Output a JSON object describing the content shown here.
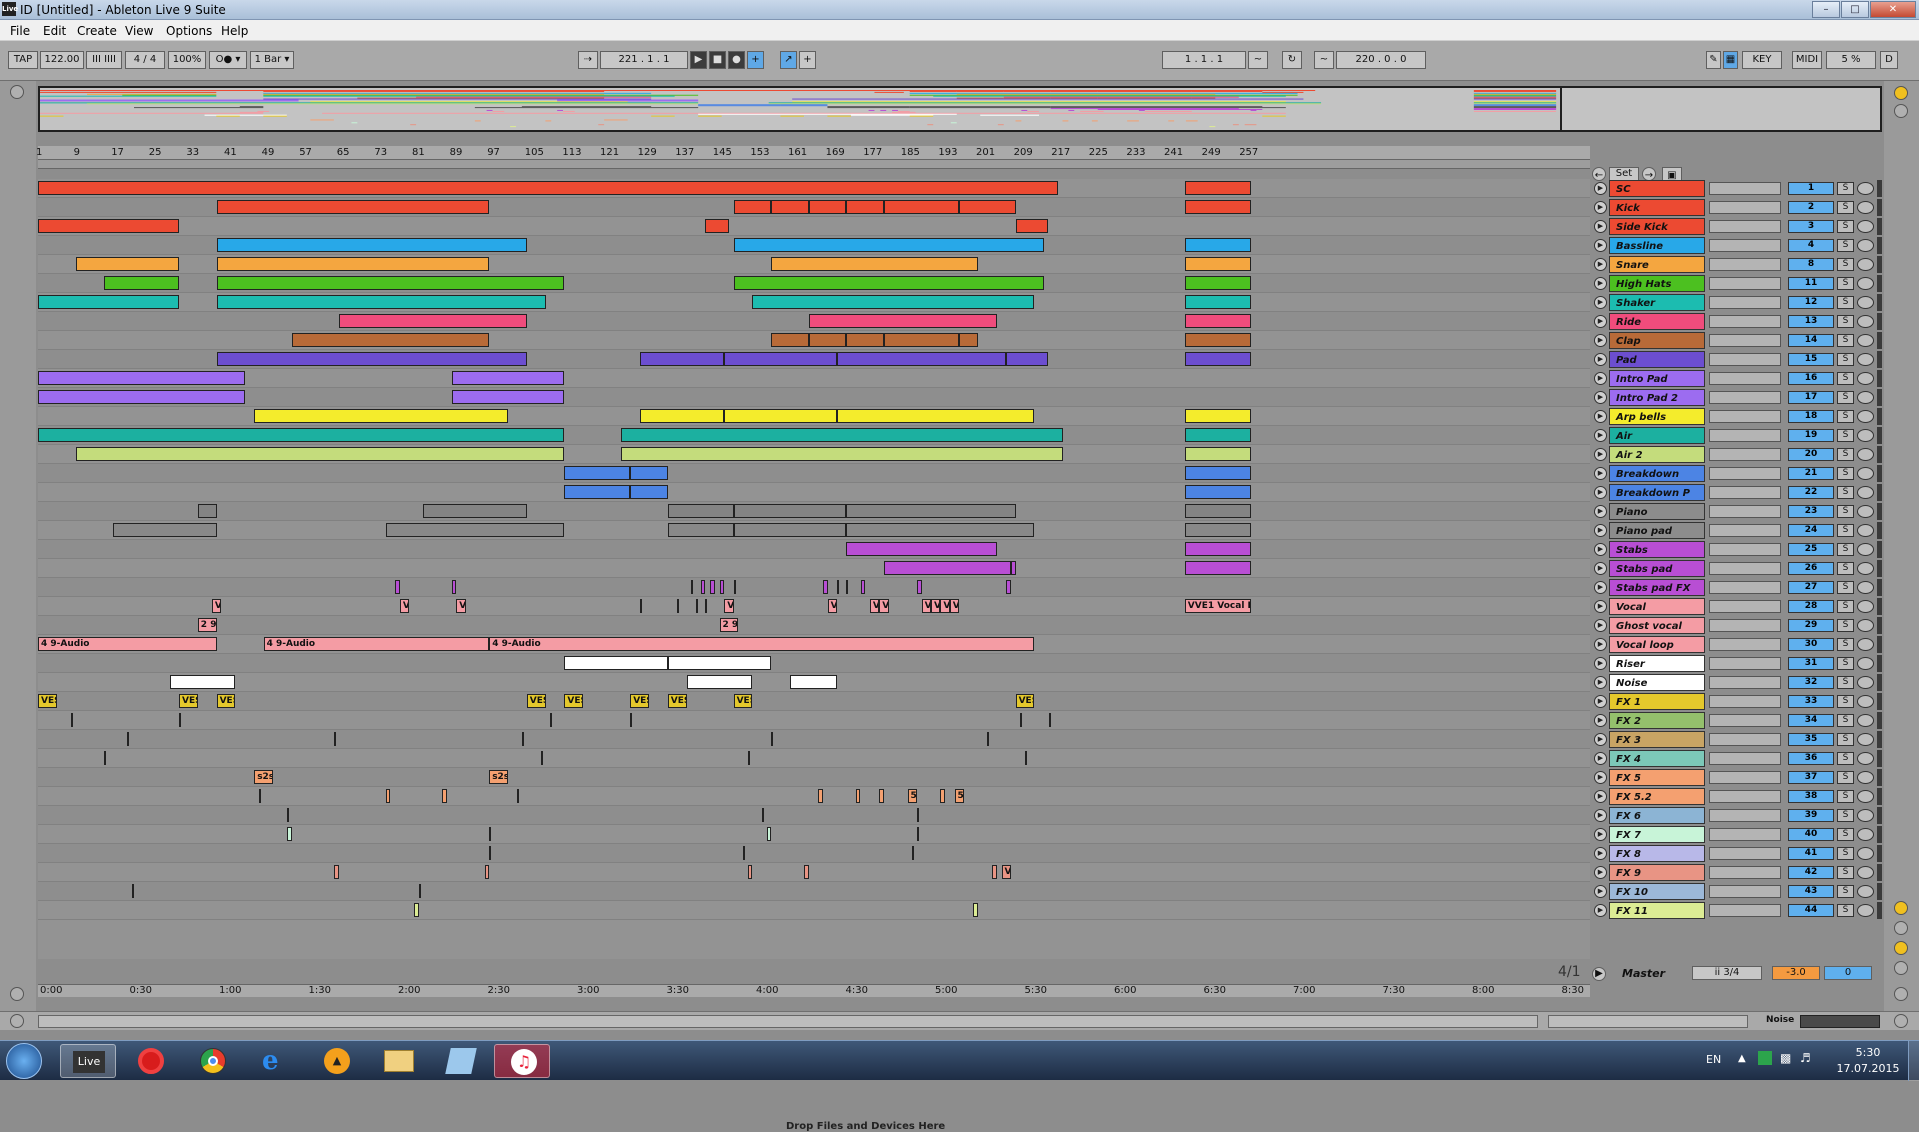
{
  "window": {
    "title": "ID  [Untitled] - Ableton Live 9 Suite",
    "app_icon": "Live"
  },
  "menu": [
    "File",
    "Edit",
    "Create",
    "View",
    "Options",
    "Help"
  ],
  "transport": {
    "tap": "TAP",
    "tempo": "122.00",
    "metronome_bars": "III  IIII",
    "signature": "4 / 4",
    "zoom": "100%",
    "rec_mode": "O● ▾",
    "quantize": "1 Bar ▾",
    "follow": "⇢",
    "position": "221 .  1 .  1",
    "loop_start": "1 .  1 .  1",
    "loop_length": "220 .  0 .  0",
    "key_btn": "KEY",
    "midi_btn": "MIDI",
    "cpu": "5 %",
    "d_btn": "D"
  },
  "ruler_bars": [
    "1",
    "9",
    "17",
    "25",
    "33",
    "41",
    "49",
    "57",
    "65",
    "73",
    "81",
    "89",
    "97",
    "105",
    "113",
    "121",
    "129",
    "137",
    "145",
    "153",
    "161",
    "169",
    "177",
    "185",
    "193",
    "201",
    "209",
    "217",
    "225",
    "233",
    "241",
    "249",
    "257"
  ],
  "time_ruler": [
    "0:00",
    "0:30",
    "1:00",
    "1:30",
    "2:00",
    "2:30",
    "3:00",
    "3:30",
    "4:00",
    "4:30",
    "5:00",
    "5:30",
    "6:00",
    "6:30",
    "7:00",
    "7:30",
    "8:00",
    "8:30"
  ],
  "drop_text": "Drop Files and Devices Here",
  "set_btn": "Set",
  "tracks": [
    {
      "name": "SC",
      "color": "#ec4a32",
      "num": "1",
      "solo": "S"
    },
    {
      "name": "Kick",
      "color": "#ec4a32",
      "num": "2",
      "solo": "S"
    },
    {
      "name": "Side Kick",
      "color": "#ec4a32",
      "num": "3",
      "solo": "S"
    },
    {
      "name": "Bassline",
      "color": "#28a8e8",
      "num": "4",
      "solo": "S"
    },
    {
      "name": "Snare",
      "color": "#f4a640",
      "num": "8",
      "solo": "S"
    },
    {
      "name": "High Hats",
      "color": "#4cc020",
      "num": "11",
      "solo": "S"
    },
    {
      "name": "Shaker",
      "color": "#1cbcb0",
      "num": "12",
      "solo": "S"
    },
    {
      "name": "Ride",
      "color": "#f04c7c",
      "num": "13",
      "solo": "S"
    },
    {
      "name": "Clap",
      "color": "#b86a38",
      "num": "14",
      "solo": "S"
    },
    {
      "name": "Pad",
      "color": "#6c4ed0",
      "num": "15",
      "solo": "S"
    },
    {
      "name": "Intro Pad",
      "color": "#9c6cf0",
      "num": "16",
      "solo": "S"
    },
    {
      "name": "Intro Pad 2",
      "color": "#9c6cf0",
      "num": "17",
      "solo": "S"
    },
    {
      "name": "Arp bells",
      "color": "#f4ec2c",
      "num": "18",
      "solo": "S"
    },
    {
      "name": "Air",
      "color": "#1cb0a0",
      "num": "19",
      "solo": "S"
    },
    {
      "name": "Air 2",
      "color": "#c4dc7c",
      "num": "20",
      "solo": "S"
    },
    {
      "name": "Breakdown",
      "color": "#4c84e4",
      "num": "21",
      "solo": "S"
    },
    {
      "name": "Breakdown P",
      "color": "#4c84e4",
      "num": "22",
      "solo": "S"
    },
    {
      "name": "Piano",
      "color": "#8c8c8c",
      "num": "23",
      "solo": "S"
    },
    {
      "name": "Piano pad",
      "color": "#8c8c8c",
      "num": "24",
      "solo": "S"
    },
    {
      "name": "Stabs",
      "color": "#b84ed4",
      "num": "25",
      "solo": "S"
    },
    {
      "name": "Stabs pad",
      "color": "#b84ed4",
      "num": "26",
      "solo": "S"
    },
    {
      "name": "Stabs pad FX",
      "color": "#b84ed4",
      "num": "27",
      "solo": "S"
    },
    {
      "name": "Vocal",
      "color": "#f49ca4",
      "num": "28",
      "solo": "S"
    },
    {
      "name": "Ghost vocal",
      "color": "#f49ca4",
      "num": "29",
      "solo": "S"
    },
    {
      "name": "Vocal loop",
      "color": "#f49ca4",
      "num": "30",
      "solo": "S"
    },
    {
      "name": "Riser",
      "color": "#ffffff",
      "num": "31",
      "solo": "S"
    },
    {
      "name": "Noise",
      "color": "#ffffff",
      "num": "32",
      "solo": "S"
    },
    {
      "name": "FX 1",
      "color": "#e4c82c",
      "num": "33",
      "solo": "S"
    },
    {
      "name": "FX 2",
      "color": "#94c06c",
      "num": "34",
      "solo": "S"
    },
    {
      "name": "FX 3",
      "color": "#c8a464",
      "num": "35",
      "solo": "S"
    },
    {
      "name": "FX 4",
      "color": "#7cc8b8",
      "num": "36",
      "solo": "S"
    },
    {
      "name": "FX 5",
      "color": "#f4a070",
      "num": "37",
      "solo": "S"
    },
    {
      "name": "FX 5.2",
      "color": "#f4a070",
      "num": "38",
      "solo": "S"
    },
    {
      "name": "FX 6",
      "color": "#8cb4d4",
      "num": "39",
      "solo": "S"
    },
    {
      "name": "FX 7",
      "color": "#c8f4d8",
      "num": "40",
      "solo": "S"
    },
    {
      "name": "FX 8",
      "color": "#b8b8e8",
      "num": "41",
      "solo": "S"
    },
    {
      "name": "FX 9",
      "color": "#e89484",
      "num": "42",
      "solo": "S"
    },
    {
      "name": "FX 10",
      "color": "#9cb8d8",
      "num": "43",
      "solo": "S"
    },
    {
      "name": "FX 11",
      "color": "#dcec94",
      "num": "44",
      "solo": "S"
    }
  ],
  "clips": [
    {
      "t": 0,
      "s": 1,
      "e": 218,
      "c": "#ec4a32"
    },
    {
      "t": 0,
      "s": 245,
      "e": 259,
      "c": "#ec4a32"
    },
    {
      "t": 1,
      "s": 39,
      "e": 97,
      "c": "#ec4a32"
    },
    {
      "t": 1,
      "s": 149,
      "e": 157,
      "c": "#ec4a32"
    },
    {
      "t": 1,
      "s": 157,
      "e": 165,
      "c": "#ec4a32"
    },
    {
      "t": 1,
      "s": 165,
      "e": 173,
      "c": "#ec4a32"
    },
    {
      "t": 1,
      "s": 173,
      "e": 181,
      "c": "#ec4a32"
    },
    {
      "t": 1,
      "s": 181,
      "e": 197,
      "c": "#ec4a32"
    },
    {
      "t": 1,
      "s": 197,
      "e": 209,
      "c": "#ec4a32"
    },
    {
      "t": 1,
      "s": 245,
      "e": 259,
      "c": "#ec4a32"
    },
    {
      "t": 2,
      "s": 1,
      "e": 31,
      "c": "#ec4a32"
    },
    {
      "t": 2,
      "s": 143,
      "e": 148,
      "c": "#ec4a32"
    },
    {
      "t": 2,
      "s": 209,
      "e": 216,
      "c": "#ec4a32"
    },
    {
      "t": 3,
      "s": 39,
      "e": 105,
      "c": "#28a8e8"
    },
    {
      "t": 3,
      "s": 149,
      "e": 215,
      "c": "#28a8e8"
    },
    {
      "t": 3,
      "s": 245,
      "e": 259,
      "c": "#28a8e8"
    },
    {
      "t": 4,
      "s": 9,
      "e": 31,
      "c": "#f4a640"
    },
    {
      "t": 4,
      "s": 39,
      "e": 97,
      "c": "#f4a640"
    },
    {
      "t": 4,
      "s": 157,
      "e": 201,
      "c": "#f4a640"
    },
    {
      "t": 4,
      "s": 245,
      "e": 259,
      "c": "#f4a640"
    },
    {
      "t": 5,
      "s": 15,
      "e": 31,
      "c": "#4cc020"
    },
    {
      "t": 5,
      "s": 39,
      "e": 113,
      "c": "#4cc020"
    },
    {
      "t": 5,
      "s": 149,
      "e": 215,
      "c": "#4cc020"
    },
    {
      "t": 5,
      "s": 245,
      "e": 259,
      "c": "#4cc020"
    },
    {
      "t": 6,
      "s": 1,
      "e": 31,
      "c": "#1cbcb0"
    },
    {
      "t": 6,
      "s": 39,
      "e": 109,
      "c": "#1cbcb0"
    },
    {
      "t": 6,
      "s": 153,
      "e": 213,
      "c": "#1cbcb0"
    },
    {
      "t": 6,
      "s": 245,
      "e": 259,
      "c": "#1cbcb0"
    },
    {
      "t": 7,
      "s": 65,
      "e": 105,
      "c": "#f04c7c"
    },
    {
      "t": 7,
      "s": 165,
      "e": 205,
      "c": "#f04c7c"
    },
    {
      "t": 7,
      "s": 245,
      "e": 259,
      "c": "#f04c7c"
    },
    {
      "t": 8,
      "s": 55,
      "e": 97,
      "c": "#b86a38"
    },
    {
      "t": 8,
      "s": 157,
      "e": 165,
      "c": "#b86a38"
    },
    {
      "t": 8,
      "s": 165,
      "e": 173,
      "c": "#b86a38"
    },
    {
      "t": 8,
      "s": 173,
      "e": 181,
      "c": "#b86a38"
    },
    {
      "t": 8,
      "s": 181,
      "e": 197,
      "c": "#b86a38"
    },
    {
      "t": 8,
      "s": 197,
      "e": 201,
      "c": "#b86a38"
    },
    {
      "t": 8,
      "s": 245,
      "e": 259,
      "c": "#b86a38"
    },
    {
      "t": 9,
      "s": 39,
      "e": 105,
      "c": "#6c4ed0"
    },
    {
      "t": 9,
      "s": 129,
      "e": 147,
      "c": "#6c4ed0"
    },
    {
      "t": 9,
      "s": 147,
      "e": 171,
      "c": "#6c4ed0"
    },
    {
      "t": 9,
      "s": 171,
      "e": 207,
      "c": "#6c4ed0"
    },
    {
      "t": 9,
      "s": 207,
      "e": 216,
      "c": "#6c4ed0"
    },
    {
      "t": 9,
      "s": 245,
      "e": 259,
      "c": "#6c4ed0"
    },
    {
      "t": 10,
      "s": 1,
      "e": 45,
      "c": "#9c6cf0"
    },
    {
      "t": 10,
      "s": 89,
      "e": 113,
      "c": "#9c6cf0"
    },
    {
      "t": 11,
      "s": 1,
      "e": 45,
      "c": "#9c6cf0"
    },
    {
      "t": 11,
      "s": 89,
      "e": 113,
      "c": "#9c6cf0"
    },
    {
      "t": 12,
      "s": 47,
      "e": 101,
      "c": "#f4ec2c"
    },
    {
      "t": 12,
      "s": 129,
      "e": 147,
      "c": "#f4ec2c"
    },
    {
      "t": 12,
      "s": 147,
      "e": 171,
      "c": "#f4ec2c"
    },
    {
      "t": 12,
      "s": 171,
      "e": 213,
      "c": "#f4ec2c"
    },
    {
      "t": 12,
      "s": 245,
      "e": 259,
      "c": "#f4ec2c"
    },
    {
      "t": 13,
      "s": 1,
      "e": 113,
      "c": "#1cb0a0"
    },
    {
      "t": 13,
      "s": 125,
      "e": 219,
      "c": "#1cb0a0"
    },
    {
      "t": 13,
      "s": 245,
      "e": 259,
      "c": "#1cb0a0"
    },
    {
      "t": 14,
      "s": 9,
      "e": 113,
      "c": "#c4dc7c"
    },
    {
      "t": 14,
      "s": 125,
      "e": 219,
      "c": "#c4dc7c"
    },
    {
      "t": 14,
      "s": 245,
      "e": 259,
      "c": "#c4dc7c"
    },
    {
      "t": 15,
      "s": 113,
      "e": 127,
      "c": "#4c84e4"
    },
    {
      "t": 15,
      "s": 127,
      "e": 135,
      "c": "#4c84e4"
    },
    {
      "t": 15,
      "s": 245,
      "e": 259,
      "c": "#4c84e4"
    },
    {
      "t": 16,
      "s": 113,
      "e": 127,
      "c": "#4c84e4"
    },
    {
      "t": 16,
      "s": 127,
      "e": 135,
      "c": "#4c84e4"
    },
    {
      "t": 16,
      "s": 245,
      "e": 259,
      "c": "#4c84e4"
    },
    {
      "t": 17,
      "s": 35,
      "e": 39,
      "c": "#8c8c8c",
      "h": 1
    },
    {
      "t": 17,
      "s": 83,
      "e": 105,
      "c": "#8c8c8c",
      "h": 1
    },
    {
      "t": 17,
      "s": 135,
      "e": 149,
      "c": "#8c8c8c",
      "h": 1
    },
    {
      "t": 17,
      "s": 149,
      "e": 173,
      "c": "#8c8c8c",
      "h": 1
    },
    {
      "t": 17,
      "s": 173,
      "e": 209,
      "c": "#8c8c8c",
      "h": 1
    },
    {
      "t": 17,
      "s": 245,
      "e": 259,
      "c": "#8c8c8c",
      "h": 1
    },
    {
      "t": 18,
      "s": 17,
      "e": 39,
      "c": "#8c8c8c",
      "h": 1
    },
    {
      "t": 18,
      "s": 75,
      "e": 113,
      "c": "#8c8c8c",
      "h": 1
    },
    {
      "t": 18,
      "s": 135,
      "e": 149,
      "c": "#8c8c8c",
      "h": 1
    },
    {
      "t": 18,
      "s": 149,
      "e": 173,
      "c": "#8c8c8c",
      "h": 1
    },
    {
      "t": 18,
      "s": 173,
      "e": 213,
      "c": "#8c8c8c",
      "h": 1
    },
    {
      "t": 18,
      "s": 245,
      "e": 259,
      "c": "#8c8c8c",
      "h": 1
    },
    {
      "t": 19,
      "s": 173,
      "e": 205,
      "c": "#b84ed4"
    },
    {
      "t": 19,
      "s": 245,
      "e": 259,
      "c": "#b84ed4"
    },
    {
      "t": 20,
      "s": 181,
      "e": 208,
      "c": "#b84ed4"
    },
    {
      "t": 20,
      "s": 208,
      "e": 209,
      "c": "#b84ed4"
    },
    {
      "t": 20,
      "s": 245,
      "e": 259,
      "c": "#b84ed4"
    },
    {
      "t": 21,
      "s": 77,
      "e": 78,
      "c": "#b84ed4"
    },
    {
      "t": 21,
      "s": 89,
      "e": 90,
      "c": "#b84ed4"
    },
    {
      "t": 21,
      "s": 142,
      "e": 143,
      "c": "#b84ed4"
    },
    {
      "t": 21,
      "s": 144,
      "e": 145,
      "c": "#b84ed4"
    },
    {
      "t": 21,
      "s": 146,
      "e": 147,
      "c": "#b84ed4"
    },
    {
      "t": 21,
      "s": 168,
      "e": 169,
      "c": "#b84ed4"
    },
    {
      "t": 21,
      "s": 176,
      "e": 177,
      "c": "#b84ed4"
    },
    {
      "t": 21,
      "s": 188,
      "e": 189,
      "c": "#b84ed4"
    },
    {
      "t": 21,
      "s": 207,
      "e": 208,
      "c": "#b84ed4"
    },
    {
      "t": 22,
      "s": 38,
      "e": 40,
      "c": "#f49ca4",
      "l": "V"
    },
    {
      "t": 22,
      "s": 78,
      "e": 80,
      "c": "#f49ca4",
      "l": "V"
    },
    {
      "t": 22,
      "s": 90,
      "e": 92,
      "c": "#f49ca4",
      "l": "V"
    },
    {
      "t": 22,
      "s": 147,
      "e": 149,
      "c": "#f49ca4",
      "l": "V"
    },
    {
      "t": 22,
      "s": 169,
      "e": 171,
      "c": "#f49ca4",
      "l": "V"
    },
    {
      "t": 22,
      "s": 178,
      "e": 180,
      "c": "#f49ca4",
      "l": "V"
    },
    {
      "t": 22,
      "s": 180,
      "e": 182,
      "c": "#f49ca4",
      "l": "V"
    },
    {
      "t": 22,
      "s": 189,
      "e": 191,
      "c": "#f49ca4",
      "l": "V"
    },
    {
      "t": 22,
      "s": 191,
      "e": 193,
      "c": "#f49ca4",
      "l": "V"
    },
    {
      "t": 22,
      "s": 193,
      "e": 195,
      "c": "#f49ca4",
      "l": "V"
    },
    {
      "t": 22,
      "s": 195,
      "e": 197,
      "c": "#f49ca4",
      "l": "V"
    },
    {
      "t": 22,
      "s": 245,
      "e": 259,
      "c": "#f49ca4",
      "l": "VVE1 Vocal Phra"
    },
    {
      "t": 23,
      "s": 35,
      "e": 39,
      "c": "#f49ca4",
      "l": "2 9-A"
    },
    {
      "t": 23,
      "s": 146,
      "e": 150,
      "c": "#f49ca4",
      "l": "2 9-A"
    },
    {
      "t": 24,
      "s": 1,
      "e": 39,
      "c": "#f49ca4",
      "l": "4 9-Audio"
    },
    {
      "t": 24,
      "s": 49,
      "e": 97,
      "c": "#f49ca4",
      "l": "4 9-Audio"
    },
    {
      "t": 24,
      "s": 97,
      "e": 213,
      "c": "#f49ca4",
      "l": "4 9-Audio"
    },
    {
      "t": 25,
      "s": 113,
      "e": 135,
      "c": "#ffffff"
    },
    {
      "t": 25,
      "s": 135,
      "e": 157,
      "c": "#ffffff"
    },
    {
      "t": 26,
      "s": 29,
      "e": 43,
      "c": "#ffffff"
    },
    {
      "t": 26,
      "s": 139,
      "e": 153,
      "c": "#ffffff"
    },
    {
      "t": 26,
      "s": 161,
      "e": 171,
      "c": "#ffffff"
    },
    {
      "t": 27,
      "s": 1,
      "e": 5,
      "c": "#e4c82c",
      "l": "VES"
    },
    {
      "t": 27,
      "s": 31,
      "e": 35,
      "c": "#e4c82c",
      "l": "VES"
    },
    {
      "t": 27,
      "s": 39,
      "e": 43,
      "c": "#e4c82c",
      "l": "VES"
    },
    {
      "t": 27,
      "s": 105,
      "e": 109,
      "c": "#e4c82c",
      "l": "VES"
    },
    {
      "t": 27,
      "s": 113,
      "e": 117,
      "c": "#e4c82c",
      "l": "VES"
    },
    {
      "t": 27,
      "s": 127,
      "e": 131,
      "c": "#e4c82c",
      "l": "VES"
    },
    {
      "t": 27,
      "s": 135,
      "e": 139,
      "c": "#e4c82c",
      "l": "VES"
    },
    {
      "t": 27,
      "s": 149,
      "e": 153,
      "c": "#e4c82c",
      "l": "VES"
    },
    {
      "t": 27,
      "s": 209,
      "e": 213,
      "c": "#e4c82c",
      "l": "VES"
    },
    {
      "t": 31,
      "s": 47,
      "e": 51,
      "c": "#f4a070",
      "l": "s2s"
    },
    {
      "t": 31,
      "s": 97,
      "e": 101,
      "c": "#f4a070",
      "l": "s2s"
    },
    {
      "t": 32,
      "s": 75,
      "e": 76,
      "c": "#f4a070"
    },
    {
      "t": 32,
      "s": 87,
      "e": 88,
      "c": "#f4a070"
    },
    {
      "t": 32,
      "s": 167,
      "e": 168,
      "c": "#f4a070"
    },
    {
      "t": 32,
      "s": 175,
      "e": 176,
      "c": "#f4a070"
    },
    {
      "t": 32,
      "s": 180,
      "e": 181,
      "c": "#f4a070"
    },
    {
      "t": 32,
      "s": 186,
      "e": 188,
      "c": "#f4a070",
      "l": "5"
    },
    {
      "t": 32,
      "s": 193,
      "e": 194,
      "c": "#f4a070"
    },
    {
      "t": 32,
      "s": 196,
      "e": 198,
      "c": "#f4a070",
      "l": "5"
    },
    {
      "t": 34,
      "s": 54,
      "e": 55,
      "c": "#c8f4d8"
    },
    {
      "t": 34,
      "s": 156,
      "e": 157,
      "c": "#c8f4d8"
    },
    {
      "t": 36,
      "s": 64,
      "e": 65,
      "c": "#e89484"
    },
    {
      "t": 36,
      "s": 96,
      "e": 97,
      "c": "#e89484"
    },
    {
      "t": 36,
      "s": 152,
      "e": 153,
      "c": "#e89484"
    },
    {
      "t": 36,
      "s": 164,
      "e": 165,
      "c": "#e89484"
    },
    {
      "t": 36,
      "s": 204,
      "e": 205,
      "c": "#e89484"
    },
    {
      "t": 36,
      "s": 206,
      "e": 208,
      "c": "#e89484",
      "l": "V"
    },
    {
      "t": 38,
      "s": 81,
      "e": 82,
      "c": "#dcec94"
    },
    {
      "t": 38,
      "s": 200,
      "e": 201,
      "c": "#dcec94"
    }
  ],
  "markers": [
    {
      "t": 21,
      "b": [
        140,
        149,
        171,
        173
      ]
    },
    {
      "t": 22,
      "b": [
        129,
        137,
        141,
        143
      ]
    },
    {
      "t": 28,
      "b": [
        8,
        31,
        110,
        127,
        210,
        216
      ]
    },
    {
      "t": 29,
      "b": [
        20,
        64,
        104,
        157,
        203
      ]
    },
    {
      "t": 30,
      "b": [
        15,
        108,
        152,
        211
      ]
    },
    {
      "t": 32,
      "b": [
        48,
        103
      ]
    },
    {
      "t": 33,
      "b": [
        54,
        155,
        188
      ]
    },
    {
      "t": 34,
      "b": [
        97,
        188
      ]
    },
    {
      "t": 35,
      "b": [
        97,
        151,
        187
      ]
    },
    {
      "t": 37,
      "b": [
        21,
        82
      ]
    }
  ],
  "master": {
    "name": "Master",
    "routing": "ii 3/4",
    "volume": "-3.0",
    "pan": "0",
    "fraction": "4/1"
  },
  "status_right": "Noise",
  "taskbar": {
    "live": "Live",
    "lang": "EN",
    "time": "5:30",
    "date": "17.07.2015"
  }
}
